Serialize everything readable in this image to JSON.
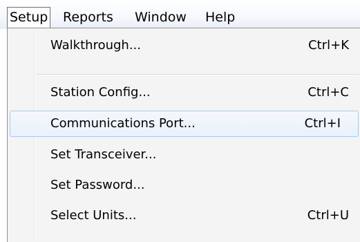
{
  "menubar": {
    "items": [
      {
        "label": "Setup",
        "open": true
      },
      {
        "label": "Reports"
      },
      {
        "label": "Window"
      },
      {
        "label": "Help"
      }
    ]
  },
  "dropdown": {
    "items": [
      {
        "label": "Walkthrough...",
        "shortcut": "Ctrl+K"
      },
      {
        "label": "Station Config...",
        "shortcut": "Ctrl+C"
      },
      {
        "label": "Communications Port...",
        "shortcut": "Ctrl+I",
        "highlighted": true
      },
      {
        "label": "Set Transceiver...",
        "shortcut": ""
      },
      {
        "label": "Set Password...",
        "shortcut": ""
      },
      {
        "label": "Select Units...",
        "shortcut": "Ctrl+U"
      }
    ]
  }
}
